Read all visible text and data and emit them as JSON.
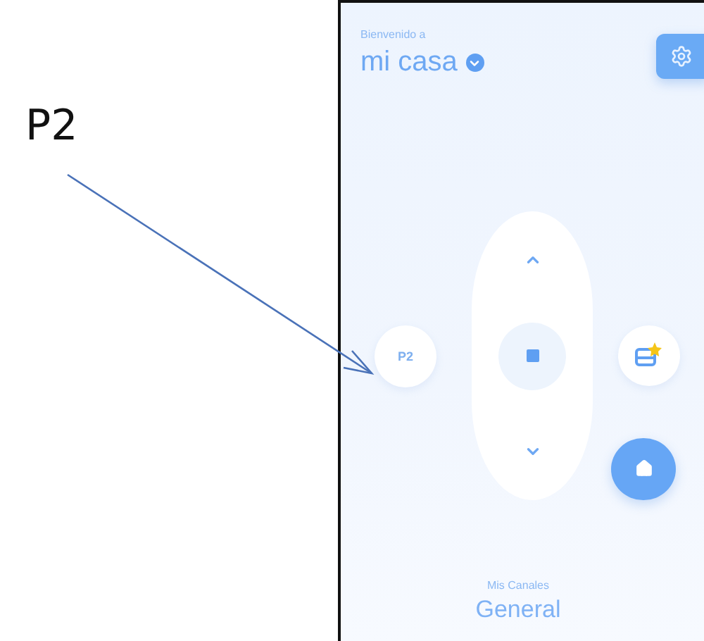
{
  "annotation": {
    "label": "P2"
  },
  "header": {
    "greeting": "Bienvenido a",
    "home_name": "mi casa"
  },
  "remote": {
    "preset_button": "P2"
  },
  "footer": {
    "caption": "Mis Canales",
    "channel": "General"
  }
}
